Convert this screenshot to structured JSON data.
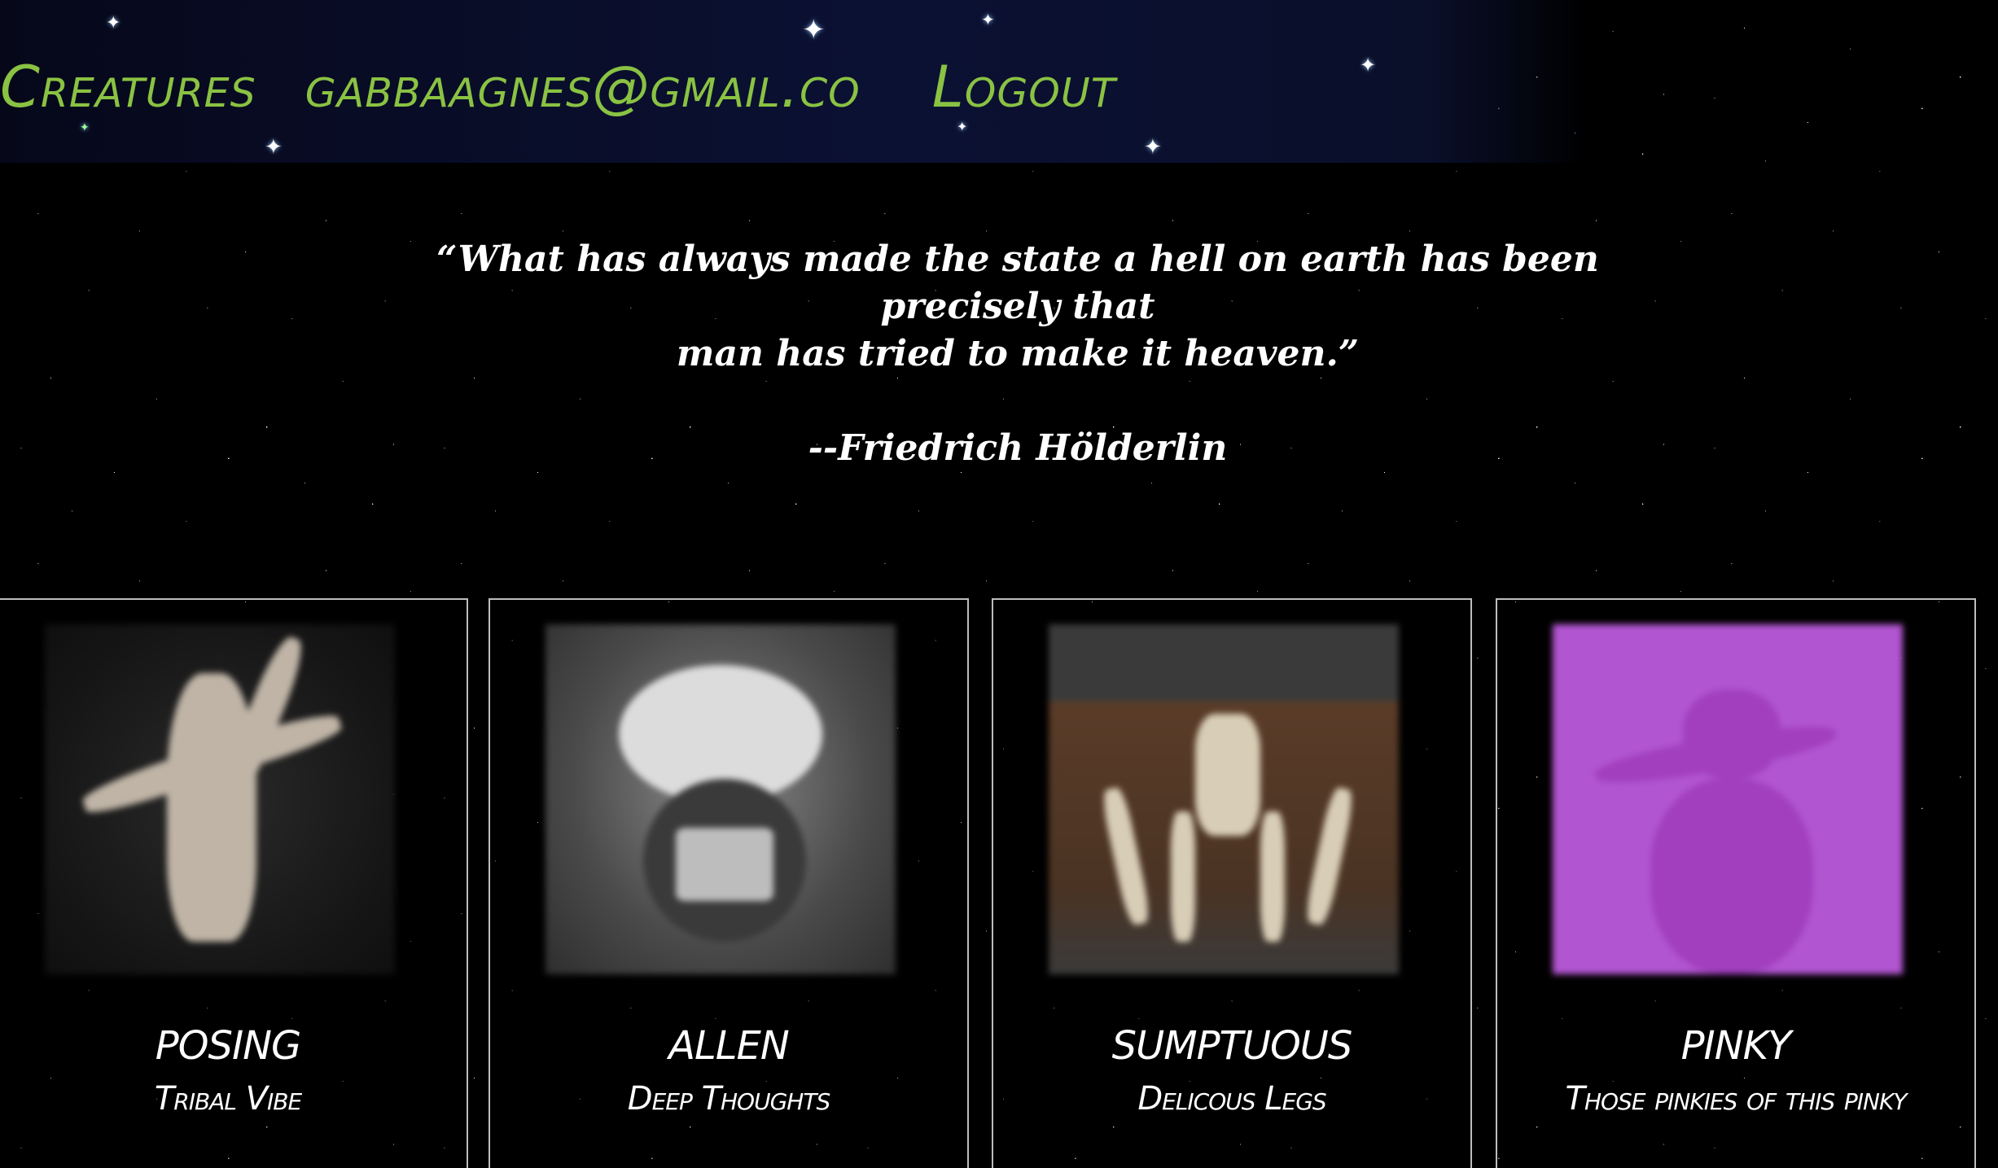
{
  "nav": {
    "items": [
      {
        "label": "Creatures"
      },
      {
        "label": "gabbaagnes@gmail.co"
      },
      {
        "label": "Logout"
      }
    ],
    "link_color": "#8ac243"
  },
  "quote": {
    "line1": "“What has always made the state a hell on earth has been precisely that",
    "line2": "man has tried to make it heaven.”",
    "attribution": "--Friedrich Hölderlin"
  },
  "cards": [
    {
      "title": "POSING",
      "subtitle": "Tribal Vibe",
      "image_icon": "creature-image"
    },
    {
      "title": "ALLEN",
      "subtitle": "Deep Thoughts",
      "image_icon": "creature-image"
    },
    {
      "title": "SUMPTUOUS",
      "subtitle": "Delicous Legs",
      "image_icon": "creature-image"
    },
    {
      "title": "PINKY",
      "subtitle": "Those pinkies of this pinky",
      "image_icon": "creature-image"
    }
  ]
}
